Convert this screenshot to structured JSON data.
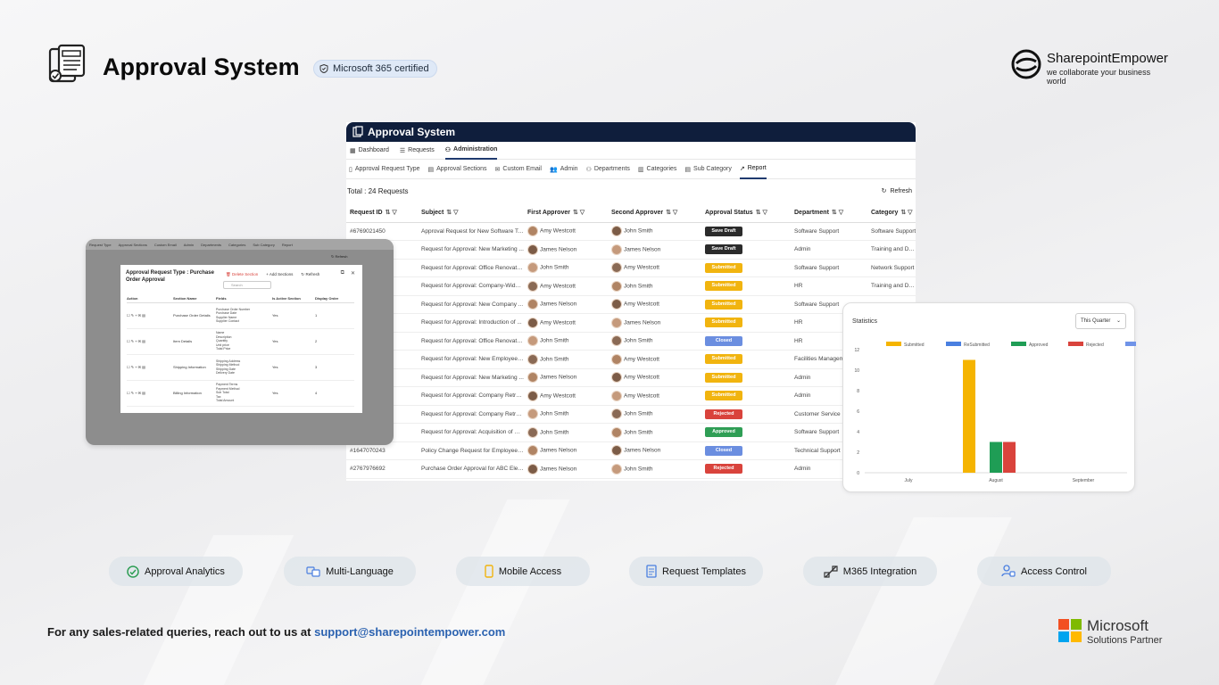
{
  "header": {
    "title": "Approval System",
    "certified": "Microsoft 365 certified",
    "brand_name": "SharepointEmpower",
    "brand_tagline": "we collaborate your business world"
  },
  "app": {
    "title": "Approval System",
    "nav_tabs": [
      "Dashboard",
      "Requests",
      "Administration"
    ],
    "active_nav": "Administration",
    "sub_tabs": [
      "Approval Request Type",
      "Approval Sections",
      "Custom Email",
      "Admin",
      "Departments",
      "Categories",
      "Sub Category",
      "Report"
    ],
    "active_sub": "Report",
    "total_label": "Total : 24 Requests",
    "refresh_label": "Refresh",
    "columns": [
      "Request ID",
      "Subject",
      "First Approver",
      "Second Approver",
      "Approval Status",
      "Department",
      "Category"
    ],
    "rows": [
      {
        "id": "#6769021450",
        "subject": "Approval Request for New Software Tool",
        "first": "Amy Westcott",
        "second": "John Smith",
        "status": "Save Draft",
        "dept": "Software Support",
        "cat": "Software Support"
      },
      {
        "id": "",
        "subject": "Request for Approval: New Marketing ...",
        "first": "James Nelson",
        "second": "James Nelson",
        "status": "Save Draft",
        "dept": "Admin",
        "cat": "Training and Deve"
      },
      {
        "id": "",
        "subject": "Request for Approval: Office Renovatio...",
        "first": "John Smith",
        "second": "Amy Westcott",
        "status": "Submitted",
        "dept": "Software Support",
        "cat": "Network Support"
      },
      {
        "id": "",
        "subject": "Request for Approval: Company-Wide ...",
        "first": "Amy Westcott",
        "second": "John Smith",
        "status": "Submitted",
        "dept": "HR",
        "cat": "Training and Deve"
      },
      {
        "id": "",
        "subject": "Request for Approval: New Company ...",
        "first": "James Nelson",
        "second": "Amy Westcott",
        "status": "Submitted",
        "dept": "Software Support",
        "cat": ""
      },
      {
        "id": "",
        "subject": "Request for Approval: Introduction of ...",
        "first": "Amy Westcott",
        "second": "James Nelson",
        "status": "Submitted",
        "dept": "HR",
        "cat": ""
      },
      {
        "id": "",
        "subject": "Request for Approval: Office Renovatio...",
        "first": "John Smith",
        "second": "John Smith",
        "status": "Closed",
        "dept": "HR",
        "cat": ""
      },
      {
        "id": "",
        "subject": "Request for Approval: New Employee T...",
        "first": "John Smith",
        "second": "Amy Westcott",
        "status": "Submitted",
        "dept": "Facilities Managem",
        "cat": ""
      },
      {
        "id": "",
        "subject": "Request for Approval: New Marketing ...",
        "first": "James Nelson",
        "second": "Amy Westcott",
        "status": "Submitted",
        "dept": "Admin",
        "cat": ""
      },
      {
        "id": "",
        "subject": "Request for Approval: Company Retreat",
        "first": "Amy Westcott",
        "second": "Amy Westcott",
        "status": "Submitted",
        "dept": "Admin",
        "cat": ""
      },
      {
        "id": "",
        "subject": "Request for Approval: Company Retreat",
        "first": "John Smith",
        "second": "John Smith",
        "status": "Rejected",
        "dept": "Customer Service",
        "cat": ""
      },
      {
        "id": "",
        "subject": "Request for Approval: Acquisition of Pr...",
        "first": "John Smith",
        "second": "John Smith",
        "status": "Approved",
        "dept": "Software Support",
        "cat": ""
      },
      {
        "id": "#1647070243",
        "subject": "Policy Change Request for Employee Tr...",
        "first": "James Nelson",
        "second": "James Nelson",
        "status": "Closed",
        "dept": "Technical Support",
        "cat": ""
      },
      {
        "id": "#2767976692",
        "subject": "Purchase Order Approval for ABC Elect...",
        "first": "James Nelson",
        "second": "John Smith",
        "status": "Rejected",
        "dept": "Admin",
        "cat": ""
      }
    ],
    "status_colors": {
      "Save Draft": "#2b2b2b",
      "Submitted": "#f1b40f",
      "Closed": "#6b8ee0",
      "Rejected": "#d9433c",
      "Approved": "#2f9e55"
    }
  },
  "modal": {
    "nav_items": [
      "Request Type",
      "Approval Sections",
      "Custom Email",
      "Admin",
      "Departments",
      "Categories",
      "Sub Category",
      "Report"
    ],
    "refresh_label": "Refresh",
    "title": "Approval Request Type : Purchase Order Approval",
    "delete_label": "Delete Section",
    "add_label": "Add Sections",
    "refresh2_label": "Refresh",
    "search_placeholder": "Search",
    "columns": [
      "Action",
      "Section Name",
      "Fields",
      "Is Active Section",
      "Display Order"
    ],
    "rows": [
      {
        "name": "Purchase Order Details",
        "fields": [
          "Purchase Order Number",
          "Purchase Date",
          "Supplier Name",
          "Supplier Contact"
        ],
        "active": "Yes",
        "order": "1"
      },
      {
        "name": "Item Details",
        "fields": [
          "Name",
          "Description",
          "Quantity",
          "Unit price",
          "Total Price"
        ],
        "active": "Yes",
        "order": "2"
      },
      {
        "name": "Shipping Information",
        "fields": [
          "Shipping Address",
          "Shipping Method",
          "Shipping Date",
          "Delivery Date"
        ],
        "active": "Yes",
        "order": "3"
      },
      {
        "name": "Billing Information",
        "fields": [
          "Payment Terms",
          "Payment Method",
          "Sub Total",
          "Tax",
          "Total Amount"
        ],
        "active": "Yes",
        "order": "4"
      }
    ]
  },
  "stats": {
    "title": "Statistics",
    "period": "This Quarter"
  },
  "chart_data": {
    "type": "bar",
    "categories": [
      "July",
      "August",
      "September"
    ],
    "series": [
      {
        "name": "Submitted",
        "color": "#f5b400",
        "values": [
          0,
          11,
          0
        ]
      },
      {
        "name": "ReSubmitted",
        "color": "#4a7fe0",
        "values": [
          0,
          0,
          0
        ]
      },
      {
        "name": "Approved",
        "color": "#1f9d55",
        "values": [
          0,
          3,
          0
        ]
      },
      {
        "name": "Rejected",
        "color": "#d9433c",
        "values": [
          0,
          3,
          0
        ]
      },
      {
        "name": "Closed",
        "color": "#6f93e8",
        "values": [
          0,
          0,
          0
        ]
      }
    ],
    "y_ticks": [
      0,
      2,
      4,
      6,
      8,
      10,
      12
    ],
    "ylim": [
      0,
      12
    ],
    "legend_position": "top"
  },
  "features": [
    {
      "label": "Approval Analytics",
      "icon": "analytics-icon"
    },
    {
      "label": "Multi-Language",
      "icon": "language-icon"
    },
    {
      "label": "Mobile Access",
      "icon": "mobile-icon"
    },
    {
      "label": "Request Templates",
      "icon": "template-icon"
    },
    {
      "label": "M365 Integration",
      "icon": "integration-icon"
    },
    {
      "label": "Access Control",
      "icon": "access-control-icon"
    }
  ],
  "footer": {
    "text": "For any sales-related queries, reach out to us at",
    "email": "support@sharepointempower.com",
    "partner_name": "Microsoft",
    "partner_sub": "Solutions Partner"
  }
}
